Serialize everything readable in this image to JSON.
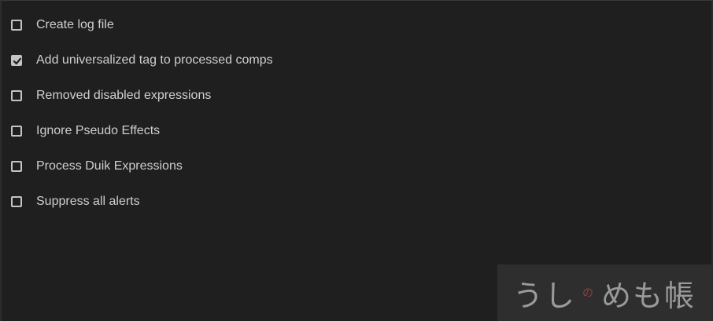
{
  "options": [
    {
      "label": "Create log file",
      "checked": false
    },
    {
      "label": "Add universalized tag to processed comps",
      "checked": true
    },
    {
      "label": "Removed disabled expressions",
      "checked": false
    },
    {
      "label": "Ignore Pseudo Effects",
      "checked": false
    },
    {
      "label": "Process Duik Expressions",
      "checked": false
    },
    {
      "label": "Suppress all alerts",
      "checked": false
    }
  ],
  "watermark": {
    "part1": "うし",
    "part2": "の",
    "part3": "めも帳"
  }
}
